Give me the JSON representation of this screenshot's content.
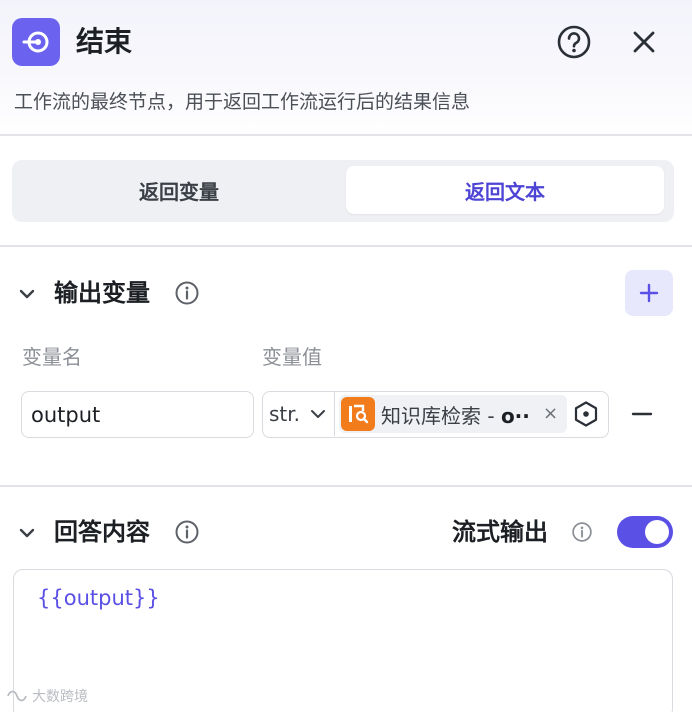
{
  "header": {
    "title": "结束",
    "description": "工作流的最终节点，用于返回工作流运行后的结果信息",
    "node_color": "#6b63f0"
  },
  "tabs": [
    {
      "label": "返回变量",
      "selected": false
    },
    {
      "label": "返回文本",
      "selected": true
    }
  ],
  "output_section": {
    "title": "输出变量",
    "columns": {
      "name": "变量名",
      "value": "变量值"
    },
    "rows": [
      {
        "name": "output",
        "type": "str.",
        "ref_node": "知识库检索",
        "ref_separator": " - ",
        "ref_var": "o··",
        "ref_color": "#f27b1c"
      }
    ]
  },
  "answer_section": {
    "title": "回答内容",
    "stream_label": "流式输出",
    "stream_enabled": true,
    "content": "{{output}}"
  },
  "watermark": "大数跨境",
  "icons": [
    "exit-node-icon",
    "help-icon",
    "close-icon",
    "chevron-down-icon",
    "info-icon",
    "plus-icon",
    "knowledge-base-icon",
    "variable-picker-icon",
    "minus-icon"
  ],
  "colors": {
    "accent": "#5a50e6",
    "tab_active_text": "#4d44d6"
  }
}
